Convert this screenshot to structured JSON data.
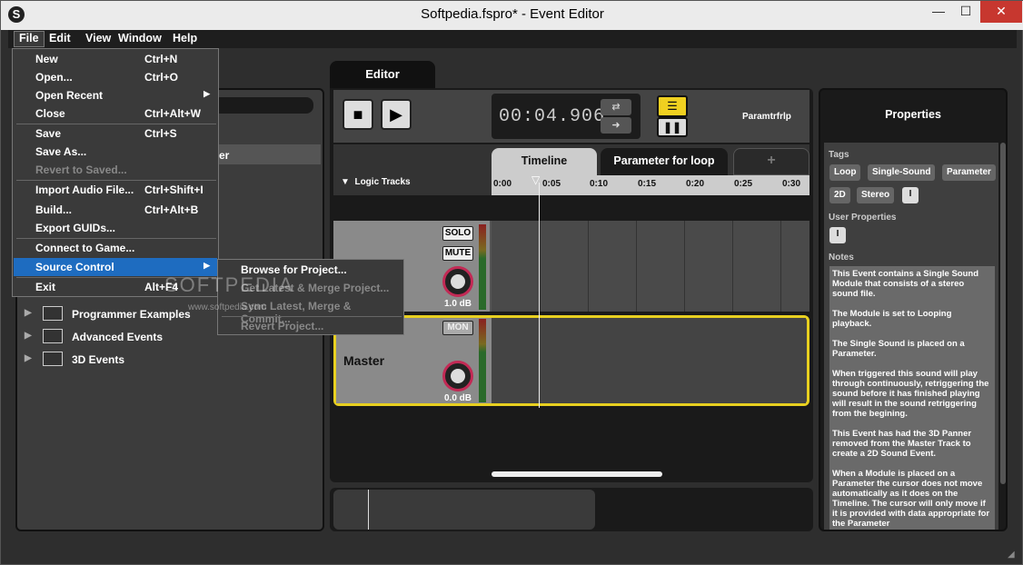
{
  "window": {
    "title": "Softpedia.fspro* - Event Editor",
    "min": "—",
    "max": "☐",
    "close": "✕"
  },
  "menubar": [
    "File",
    "Edit",
    "View",
    "Window",
    "Help"
  ],
  "file_menu": [
    {
      "label": "New",
      "shortcut": "Ctrl+N"
    },
    {
      "label": "Open...",
      "shortcut": "Ctrl+O"
    },
    {
      "label": "Open Recent",
      "shortcut": ""
    },
    {
      "label": "Close",
      "shortcut": "Ctrl+Alt+W"
    },
    {
      "label": "Save",
      "shortcut": "Ctrl+S"
    },
    {
      "label": "Save As...",
      "shortcut": ""
    },
    {
      "label": "Revert to Saved...",
      "shortcut": ""
    },
    {
      "label": "Import Audio File...",
      "shortcut": "Ctrl+Shift+I"
    },
    {
      "label": "Build...",
      "shortcut": "Ctrl+Alt+B"
    },
    {
      "label": "Export GUIDs...",
      "shortcut": ""
    },
    {
      "label": "Connect to Game...",
      "shortcut": ""
    },
    {
      "label": "Source Control",
      "shortcut": ""
    },
    {
      "label": "Exit",
      "shortcut": "Alt+F4"
    }
  ],
  "source_control_menu": [
    "Browse for Project...",
    "Get Latest & Merge Project...",
    "Sync Latest, Merge & Commit...",
    "Revert Project..."
  ],
  "browser": {
    "selected_partial": "er",
    "folders": [
      "Programmer Examples",
      "Advanced Events",
      "3D Events"
    ]
  },
  "editor": {
    "tab": "Editor",
    "time": "00:04.906",
    "param_label": "Paramtrfrlp",
    "tabs": [
      "Timeline",
      "Parameter for loop",
      "+"
    ],
    "logic_tracks": "Logic Tracks",
    "ruler": [
      "0:00",
      "0:05",
      "0:10",
      "0:15",
      "0:20",
      "0:25",
      "0:30"
    ],
    "track1": {
      "solo": "SOLO",
      "mute": "MUTE",
      "db": "1.0 dB"
    },
    "master": {
      "name": "Master",
      "mon": "MON",
      "db": "0.0 dB"
    }
  },
  "properties": {
    "title": "Properties",
    "tags_label": "Tags",
    "tags": [
      "Loop",
      "Single-Sound",
      "Parameter",
      "2D",
      "Stereo"
    ],
    "user_props_label": "User Properties",
    "notes_label": "Notes",
    "notes": [
      "This Event contains a Single Sound Module that consists of a stereo sound file.",
      "The Module is set to Looping playback.",
      "The Single Sound is placed on a Parameter.",
      "When triggered this sound will play through continuously, retriggering the sound before it has finished playing will result in the sound retriggering from the begining.",
      "This Event has had the 3D Panner removed from the Master Track to create a 2D Sound Event.",
      "When a Module is placed on a Parameter the cursor does not move automatically as it does on the Timeline. The cursor will only move if it is provided with data appropriate for the Parameter"
    ]
  },
  "watermark": {
    "big": "SOFTPEDIA",
    "small": "www.softpedia.com"
  }
}
